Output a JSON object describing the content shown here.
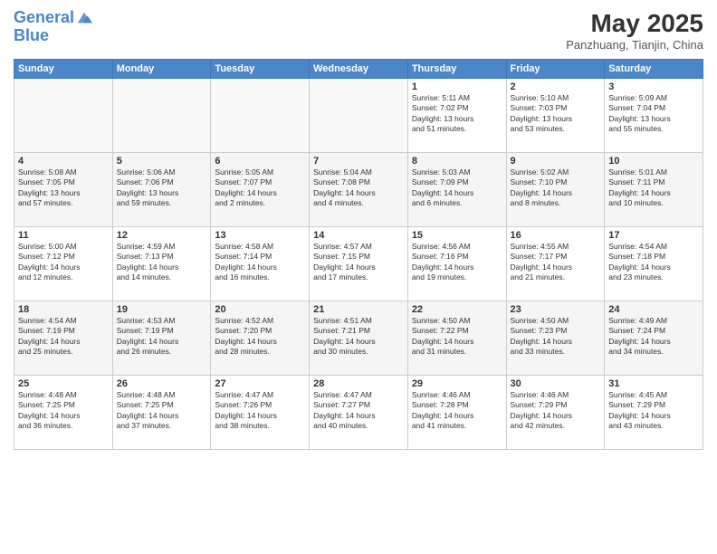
{
  "header": {
    "logo_line1": "General",
    "logo_line2": "Blue",
    "month": "May 2025",
    "location": "Panzhuang, Tianjin, China"
  },
  "days_of_week": [
    "Sunday",
    "Monday",
    "Tuesday",
    "Wednesday",
    "Thursday",
    "Friday",
    "Saturday"
  ],
  "weeks": [
    [
      {
        "day": "",
        "info": ""
      },
      {
        "day": "",
        "info": ""
      },
      {
        "day": "",
        "info": ""
      },
      {
        "day": "",
        "info": ""
      },
      {
        "day": "1",
        "info": "Sunrise: 5:11 AM\nSunset: 7:02 PM\nDaylight: 13 hours\nand 51 minutes."
      },
      {
        "day": "2",
        "info": "Sunrise: 5:10 AM\nSunset: 7:03 PM\nDaylight: 13 hours\nand 53 minutes."
      },
      {
        "day": "3",
        "info": "Sunrise: 5:09 AM\nSunset: 7:04 PM\nDaylight: 13 hours\nand 55 minutes."
      }
    ],
    [
      {
        "day": "4",
        "info": "Sunrise: 5:08 AM\nSunset: 7:05 PM\nDaylight: 13 hours\nand 57 minutes."
      },
      {
        "day": "5",
        "info": "Sunrise: 5:06 AM\nSunset: 7:06 PM\nDaylight: 13 hours\nand 59 minutes."
      },
      {
        "day": "6",
        "info": "Sunrise: 5:05 AM\nSunset: 7:07 PM\nDaylight: 14 hours\nand 2 minutes."
      },
      {
        "day": "7",
        "info": "Sunrise: 5:04 AM\nSunset: 7:08 PM\nDaylight: 14 hours\nand 4 minutes."
      },
      {
        "day": "8",
        "info": "Sunrise: 5:03 AM\nSunset: 7:09 PM\nDaylight: 14 hours\nand 6 minutes."
      },
      {
        "day": "9",
        "info": "Sunrise: 5:02 AM\nSunset: 7:10 PM\nDaylight: 14 hours\nand 8 minutes."
      },
      {
        "day": "10",
        "info": "Sunrise: 5:01 AM\nSunset: 7:11 PM\nDaylight: 14 hours\nand 10 minutes."
      }
    ],
    [
      {
        "day": "11",
        "info": "Sunrise: 5:00 AM\nSunset: 7:12 PM\nDaylight: 14 hours\nand 12 minutes."
      },
      {
        "day": "12",
        "info": "Sunrise: 4:59 AM\nSunset: 7:13 PM\nDaylight: 14 hours\nand 14 minutes."
      },
      {
        "day": "13",
        "info": "Sunrise: 4:58 AM\nSunset: 7:14 PM\nDaylight: 14 hours\nand 16 minutes."
      },
      {
        "day": "14",
        "info": "Sunrise: 4:57 AM\nSunset: 7:15 PM\nDaylight: 14 hours\nand 17 minutes."
      },
      {
        "day": "15",
        "info": "Sunrise: 4:56 AM\nSunset: 7:16 PM\nDaylight: 14 hours\nand 19 minutes."
      },
      {
        "day": "16",
        "info": "Sunrise: 4:55 AM\nSunset: 7:17 PM\nDaylight: 14 hours\nand 21 minutes."
      },
      {
        "day": "17",
        "info": "Sunrise: 4:54 AM\nSunset: 7:18 PM\nDaylight: 14 hours\nand 23 minutes."
      }
    ],
    [
      {
        "day": "18",
        "info": "Sunrise: 4:54 AM\nSunset: 7:19 PM\nDaylight: 14 hours\nand 25 minutes."
      },
      {
        "day": "19",
        "info": "Sunrise: 4:53 AM\nSunset: 7:19 PM\nDaylight: 14 hours\nand 26 minutes."
      },
      {
        "day": "20",
        "info": "Sunrise: 4:52 AM\nSunset: 7:20 PM\nDaylight: 14 hours\nand 28 minutes."
      },
      {
        "day": "21",
        "info": "Sunrise: 4:51 AM\nSunset: 7:21 PM\nDaylight: 14 hours\nand 30 minutes."
      },
      {
        "day": "22",
        "info": "Sunrise: 4:50 AM\nSunset: 7:22 PM\nDaylight: 14 hours\nand 31 minutes."
      },
      {
        "day": "23",
        "info": "Sunrise: 4:50 AM\nSunset: 7:23 PM\nDaylight: 14 hours\nand 33 minutes."
      },
      {
        "day": "24",
        "info": "Sunrise: 4:49 AM\nSunset: 7:24 PM\nDaylight: 14 hours\nand 34 minutes."
      }
    ],
    [
      {
        "day": "25",
        "info": "Sunrise: 4:48 AM\nSunset: 7:25 PM\nDaylight: 14 hours\nand 36 minutes."
      },
      {
        "day": "26",
        "info": "Sunrise: 4:48 AM\nSunset: 7:25 PM\nDaylight: 14 hours\nand 37 minutes."
      },
      {
        "day": "27",
        "info": "Sunrise: 4:47 AM\nSunset: 7:26 PM\nDaylight: 14 hours\nand 38 minutes."
      },
      {
        "day": "28",
        "info": "Sunrise: 4:47 AM\nSunset: 7:27 PM\nDaylight: 14 hours\nand 40 minutes."
      },
      {
        "day": "29",
        "info": "Sunrise: 4:46 AM\nSunset: 7:28 PM\nDaylight: 14 hours\nand 41 minutes."
      },
      {
        "day": "30",
        "info": "Sunrise: 4:46 AM\nSunset: 7:29 PM\nDaylight: 14 hours\nand 42 minutes."
      },
      {
        "day": "31",
        "info": "Sunrise: 4:45 AM\nSunset: 7:29 PM\nDaylight: 14 hours\nand 43 minutes."
      }
    ]
  ]
}
